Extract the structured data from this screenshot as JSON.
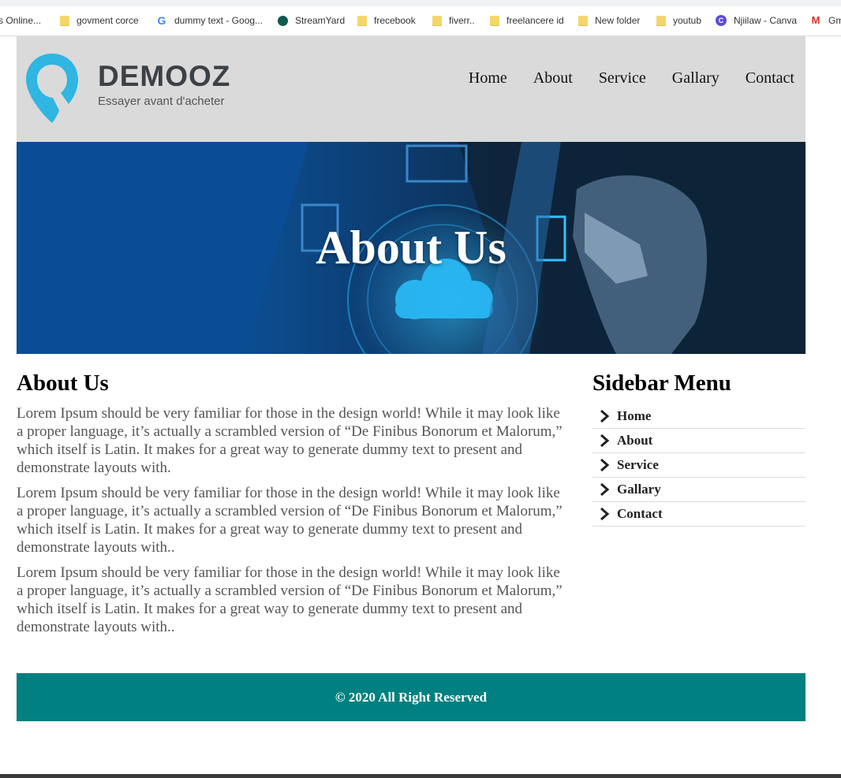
{
  "bookmarks": [
    {
      "label": "s Online...",
      "icon": "page-icon"
    },
    {
      "label": "govment corce",
      "icon": "folder-icon"
    },
    {
      "label": "dummy text - Goog...",
      "icon": "google-icon"
    },
    {
      "label": "StreamYard",
      "icon": "streamyard-icon"
    },
    {
      "label": "frecebook",
      "icon": "folder-icon"
    },
    {
      "label": "fiverr..",
      "icon": "folder-icon"
    },
    {
      "label": "freelancere id",
      "icon": "folder-icon"
    },
    {
      "label": "New folder",
      "icon": "folder-icon"
    },
    {
      "label": "youtub",
      "icon": "folder-icon"
    },
    {
      "label": "Njiilaw - Canva",
      "icon": "canva-icon"
    },
    {
      "label": "Gm",
      "icon": "gmail-icon"
    }
  ],
  "header": {
    "brand": "DEMOOZ",
    "tagline": "Essayer avant d'acheter",
    "nav": [
      "Home",
      "About",
      "Service",
      "Gallary",
      "Contact"
    ],
    "accent": "#2fb6e3"
  },
  "banner": {
    "title": "About Us"
  },
  "main": {
    "heading": "About Us",
    "paragraphs": [
      "Lorem Ipsum should be very familiar for those in the design world! While it may look like a proper language, it’s actually a scrambled version of “De Finibus Bonorum et Malorum,” which itself is Latin. It makes for a great way to generate dummy text to present and demonstrate layouts with.",
      "Lorem Ipsum should be very familiar for those in the design world! While it may look like a proper language, it’s actually a scrambled version of “De Finibus Bonorum et Malorum,” which itself is Latin. It makes for a great way to generate dummy text to present and demonstrate layouts with..",
      "Lorem Ipsum should be very familiar for those in the design world! While it may look like a proper language, it’s actually a scrambled version of “De Finibus Bonorum et Malorum,” which itself is Latin. It makes for a great way to generate dummy text to present and demonstrate layouts with.."
    ]
  },
  "sidebar": {
    "heading": "Sidebar Menu",
    "items": [
      "Home",
      "About",
      "Service",
      "Gallary",
      "Contact"
    ]
  },
  "footer": {
    "text": "© 2020 All Right Reserved",
    "color": "#008080"
  }
}
